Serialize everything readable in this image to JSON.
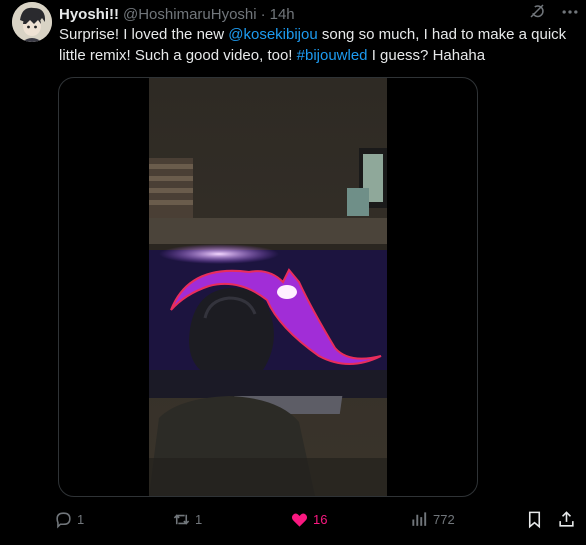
{
  "tweet": {
    "author_name": "Hyoshi!!",
    "handle": "@HoshimaruHyoshi",
    "separator": "·",
    "time": "14h",
    "text_parts": {
      "p1": "Surprise! I loved the new ",
      "mention": "@kosekibijou",
      "p2": " song so much, I had to make a quick little remix! Such a good video, too! ",
      "hashtag": "#bijouwled",
      "p3": " I guess? Hahaha"
    }
  },
  "actions": {
    "replies": "1",
    "reposts": "1",
    "likes": "16",
    "views": "772"
  },
  "icons": [
    "avatar",
    "grok-icon",
    "more-icon",
    "reply-icon",
    "repost-icon",
    "heart-icon",
    "views-icon",
    "bookmark-icon",
    "share-icon"
  ],
  "colors": {
    "accent": "#1d9bf0",
    "like": "#f91880",
    "muted": "#71767b"
  }
}
